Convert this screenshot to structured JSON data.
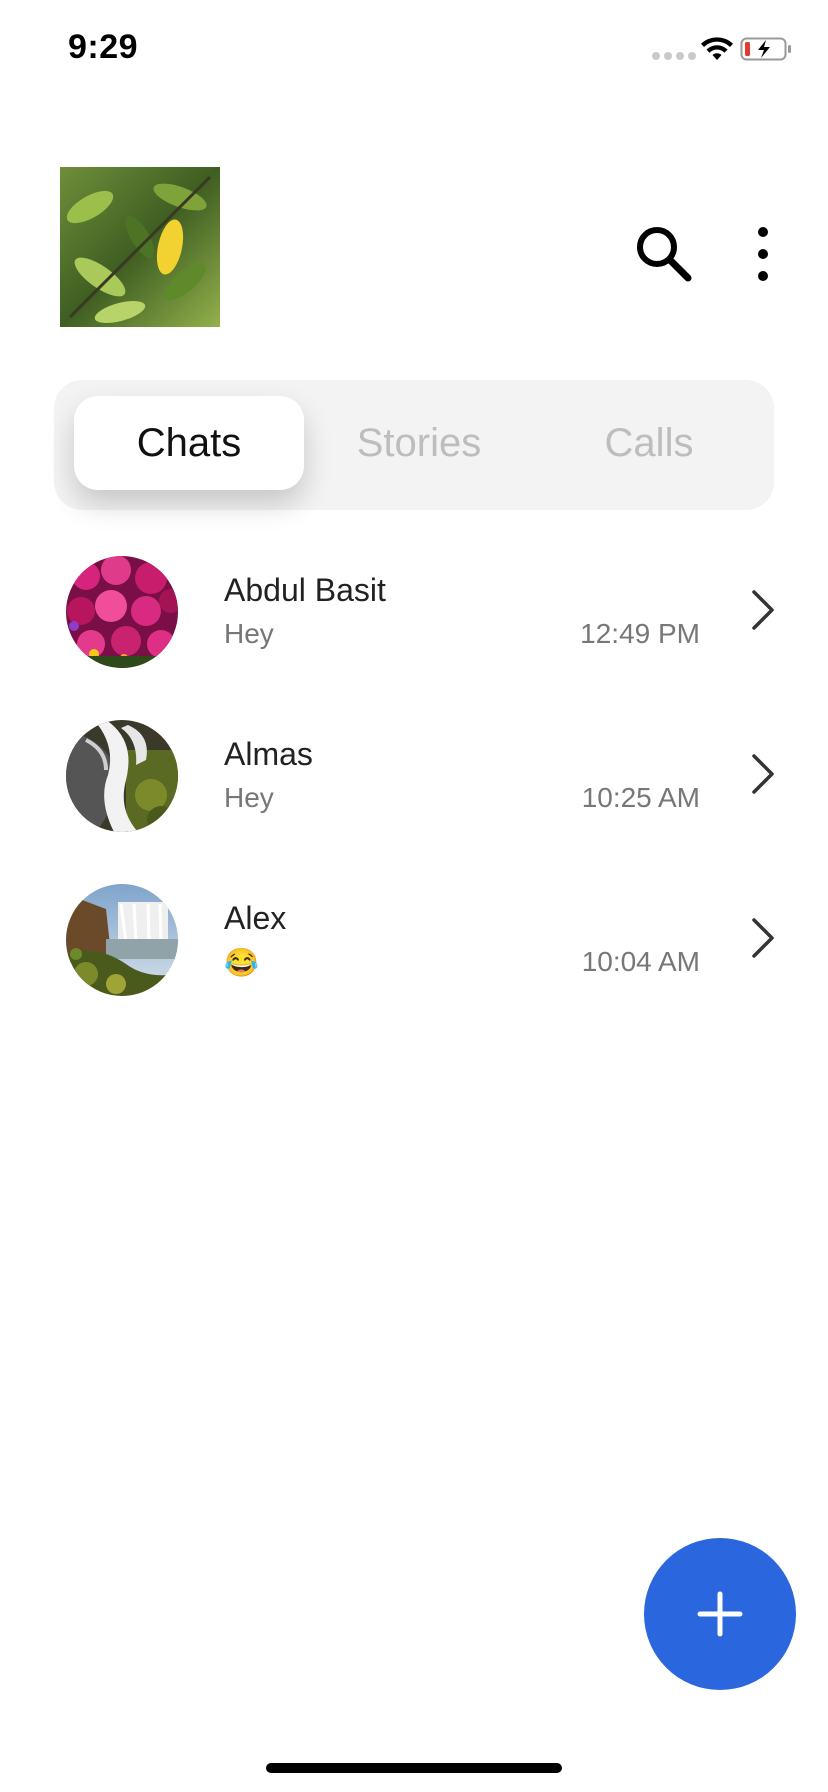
{
  "status_bar": {
    "time": "9:29"
  },
  "header": {
    "profile_icon": "profile-photo",
    "search_icon": "search-icon",
    "menu_icon": "more-vertical-icon"
  },
  "tabs": [
    {
      "label": "Chats",
      "active": true
    },
    {
      "label": "Stories",
      "active": false
    },
    {
      "label": "Calls",
      "active": false
    }
  ],
  "chats": [
    {
      "name": "Abdul Basit",
      "preview": "Hey",
      "time": "12:49 PM"
    },
    {
      "name": "Almas",
      "preview": "Hey",
      "time": "10:25 AM"
    },
    {
      "name": "Alex",
      "preview": "😂",
      "time": "10:04 AM"
    }
  ],
  "colors": {
    "accent": "#2a67de",
    "segmented_bg": "#f3f3f3",
    "inactive_tab": "#bdbdbd"
  },
  "fab": {
    "icon": "plus-icon"
  }
}
